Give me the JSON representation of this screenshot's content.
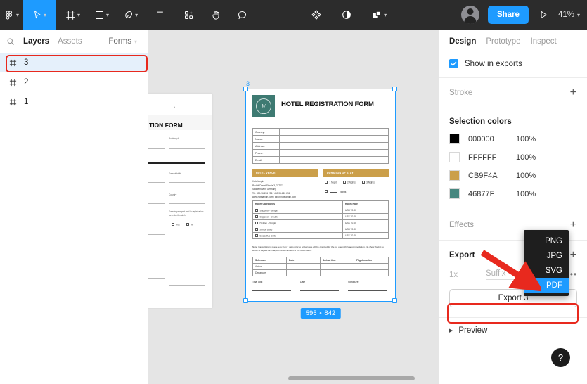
{
  "toolbar": {
    "menu_icon": "figma-logo-icon",
    "tools": [
      {
        "name": "main-menu",
        "icon": "figma-logo-icon",
        "caret": true,
        "active": false
      },
      {
        "name": "move-tool",
        "icon": "cursor-icon",
        "caret": true,
        "active": true
      },
      {
        "name": "frame-tool",
        "icon": "frame-icon",
        "caret": true,
        "active": false
      },
      {
        "name": "shape-tool",
        "icon": "square-icon",
        "caret": true,
        "active": false
      },
      {
        "name": "pen-tool",
        "icon": "pen-icon",
        "caret": true,
        "active": false
      },
      {
        "name": "text-tool",
        "icon": "text-icon",
        "caret": false,
        "active": false
      },
      {
        "name": "resources-tool",
        "icon": "components-plus-icon",
        "caret": false,
        "active": false
      },
      {
        "name": "hand-tool",
        "icon": "hand-icon",
        "caret": false,
        "active": false
      },
      {
        "name": "comment-tool",
        "icon": "comment-icon",
        "caret": false,
        "active": false
      }
    ],
    "right_tools": [
      {
        "name": "component-tool",
        "icon": "diamond-components-icon",
        "caret": false
      },
      {
        "name": "mask-tool",
        "icon": "half-circle-mask-icon",
        "caret": false
      },
      {
        "name": "boolean-tool",
        "icon": "union-shapes-icon",
        "caret": true
      }
    ],
    "share_label": "Share",
    "present_icon": "play-icon",
    "zoom_label": "41%"
  },
  "left_panel": {
    "search_icon": "search-icon",
    "tabs": [
      {
        "label": "Layers",
        "active": true
      },
      {
        "label": "Assets",
        "active": false
      }
    ],
    "page_name": "Forms",
    "layers": [
      {
        "name": "3",
        "icon": "frame-icon",
        "selected": true
      },
      {
        "name": "2",
        "icon": "frame-icon",
        "selected": false
      },
      {
        "name": "1",
        "icon": "frame-icon",
        "selected": false
      }
    ]
  },
  "canvas": {
    "frame_label": "3",
    "dimensions_badge": "595 × 842",
    "scrollbar": "horizontal-scrollbar",
    "partial_doc": {
      "title_fragment": "TION FORM",
      "top_fragment": "rt",
      "fields": [
        "Booking #",
        "Date of birth",
        "Country",
        "Date in passport and in registration form don't match"
      ],
      "yes_no": [
        "Yes",
        "No"
      ]
    },
    "document": {
      "logo_monogram": "W",
      "logo_subtext": "HOTEL",
      "title": "HOTEL REGISTRATION FORM",
      "info_rows": [
        "Country:",
        "Name:",
        "Address:",
        "Phone:",
        "Email:"
      ],
      "venue_band": "HOTEL VENUE",
      "duration_band": "DURATION OF STAY",
      "venue_lines": [
        "Hotel Angin",
        "Rudolf-Donat-Straße 3, 27777",
        "Sadderhoven, Germany",
        "Tel: 490-96-226 256  /  490-96-226 256",
        "www.hotelangin.com  /  info@hotelangin.com"
      ],
      "duration_options": [
        "1 Night",
        "2 Nights",
        "3 Nights"
      ],
      "duration_other": "Nights",
      "room_headers": [
        "Room Categories",
        "Room Rate"
      ],
      "room_rows": [
        {
          "category": "Superior - Single",
          "rate": "US$ 70.00"
        },
        {
          "category": "Superior - Double",
          "rate": "US$ 70.00"
        },
        {
          "category": "Deluxe - Single",
          "rate": "US$ 70.00"
        },
        {
          "category": "Junior Suite",
          "rate": "US$ 70.00"
        },
        {
          "category": "Executive Suite",
          "rate": "US$ 70.00"
        }
      ],
      "note": "Note: Cancellations made less than 7 days prior to arrival date will be charged for the full one night's accommodation. No show (failing to arrive at all) will be charged the full amount of the reservation.",
      "schedule_headers": [
        "Schedule",
        "Date",
        "Arrival time",
        "Flight number"
      ],
      "schedule_rows": [
        "Arrival",
        "Departure"
      ],
      "footer_fields": [
        "Total cost",
        "Date",
        "Signature"
      ]
    }
  },
  "right_panel": {
    "tabs": [
      {
        "label": "Design",
        "active": true
      },
      {
        "label": "Prototype",
        "active": false
      },
      {
        "label": "Inspect",
        "active": false
      }
    ],
    "show_in_exports": {
      "label": "Show in exports",
      "checked": true
    },
    "stroke": {
      "label": "Stroke",
      "add_icon": "plus-icon"
    },
    "selection_colors": {
      "label": "Selection colors",
      "colors": [
        {
          "hex": "000000",
          "swatch": "#000000",
          "opacity": "100%"
        },
        {
          "hex": "FFFFFF",
          "swatch": "#FFFFFF",
          "opacity": "100%"
        },
        {
          "hex": "CB9F4A",
          "swatch": "#CB9F4A",
          "opacity": "100%"
        },
        {
          "hex": "46877F",
          "swatch": "#46877F",
          "opacity": "100%"
        }
      ]
    },
    "effects": {
      "label": "Effects",
      "add_icon": "plus-icon"
    },
    "export": {
      "label": "Export",
      "add_icon": "plus-icon",
      "scale": "1x",
      "suffix_placeholder": "Suffix",
      "more_icon": "ellipsis-icon",
      "button_label": "Export 3"
    },
    "preview": {
      "label": "Preview",
      "triangle_icon": "triangle-right-icon"
    },
    "format_dropdown": {
      "options": [
        "PNG",
        "JPG",
        "SVG",
        "PDF"
      ],
      "selected": "PDF",
      "check_icon": "check-icon"
    }
  },
  "help": {
    "label": "?",
    "icon": "question-mark-icon"
  },
  "annotations": {
    "highlight_color": "#E8291E",
    "arrow": "red-arrow-pointing-to-pdf"
  }
}
